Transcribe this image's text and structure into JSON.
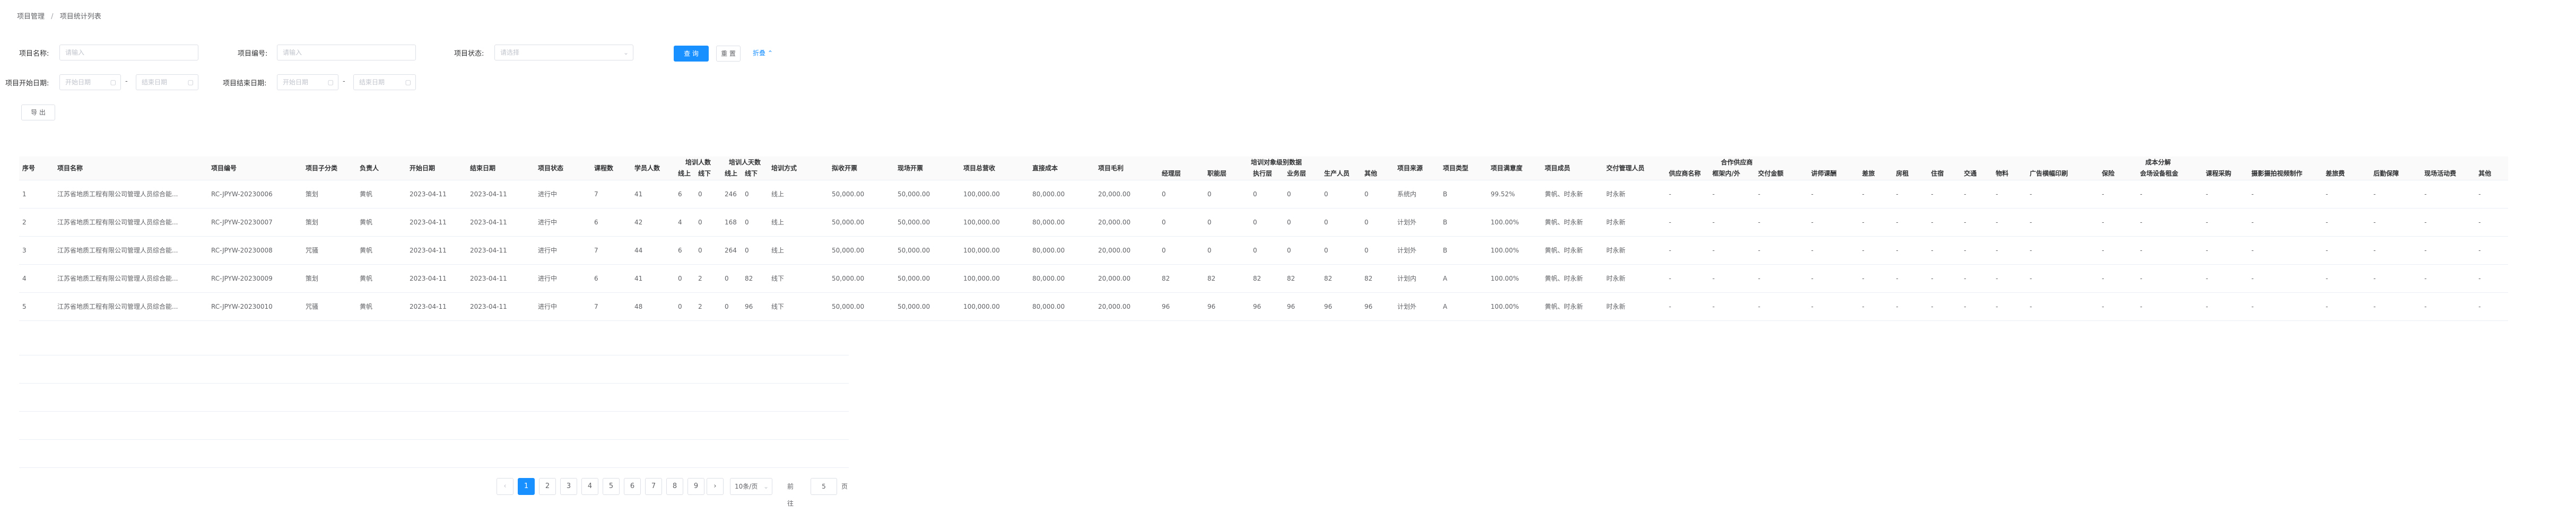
{
  "breadcrumb": {
    "parent": "项目管理",
    "separator": "/",
    "current": "项目统计列表"
  },
  "search": {
    "name_label": "项目名称:",
    "name_placeholder": "请输入",
    "code_label": "项目编号:",
    "code_placeholder": "请输入",
    "status_label": "项目状态:",
    "status_placeholder": "请选择",
    "start_label": "项目开始日期:",
    "start_from_placeholder": "开始日期",
    "start_to_placeholder": "结束日期",
    "end_label": "项目结束日期:",
    "end_from_placeholder": "开始日期",
    "end_to_placeholder": "结束日期",
    "range_sep": "-",
    "search_button": "查 询",
    "reset_button": "重 置",
    "collapse_button": "折叠"
  },
  "toolbar": {
    "export_button": "导 出"
  },
  "table": {
    "group_headers": {
      "trainee_count": "培训人数",
      "trainee_times": "培训人天数",
      "trainee_levels": "培训对象级别数据",
      "partner": "合作供应商",
      "cost_breakdown": "成本分解"
    },
    "headers": {
      "idx": "序号",
      "name": "项目名称",
      "code": "项目编号",
      "subtype": "项目子分类",
      "owner": "负责人",
      "start": "开始日期",
      "end": "结束日期",
      "status": "项目状态",
      "courses": "课程数",
      "students": "学员人数",
      "online": "线上",
      "offline": "线下",
      "online2": "线上",
      "offline2": "线下",
      "mode": "培训方式",
      "fee": "拟收开票",
      "invoiced": "现场开票",
      "total_rev": "项目总营收",
      "direct_cost": "直接成本",
      "gross": "项目毛利",
      "lvl_mgr": "经理层",
      "lvl_dept": "职能层",
      "lvl_exec": "执行层",
      "lvl_biz": "业务层",
      "lvl_prod": "生产人员",
      "lvl_other": "其他",
      "source": "项目来源",
      "category": "项目类型",
      "satisfaction": "项目满意度",
      "members": "项目成员",
      "delivery": "交付管理人员",
      "sup_name": "供应商名称",
      "sup_scope": "框架内/外",
      "sup_amount": "交付金额",
      "c_lecture": "讲师课酬",
      "c_travel": "差旅",
      "c_hotel": "房租",
      "c_stay": "住宿",
      "c_traffic": "交通",
      "c_material": "物料",
      "c_ad": "广告横幅印刷",
      "c_insurance": "保险",
      "c_venue": "会场设备租金",
      "c_course": "课程采购",
      "c_video": "摄影摄拍视频制作",
      "c_fee": "差旅费",
      "c_report": "后勤保障",
      "c_misc": "现场活动费",
      "c_other": "其他"
    },
    "rows": [
      {
        "idx": "1",
        "name": "江苏省地质工程有限公司管理人员综合能...",
        "code": "RC-JPYW-20230006",
        "subtype": "策划",
        "owner": "黄帆",
        "start": "2023-04-11",
        "end": "2023-04-11",
        "status": "进行中",
        "courses": "7",
        "students": "41",
        "online": "6",
        "offline": "0",
        "online2": "246",
        "offline2": "0",
        "mode": "线上",
        "fee": "50,000.00",
        "invoiced": "50,000.00",
        "total_rev": "100,000.00",
        "direct_cost": "80,000.00",
        "gross": "20,000.00",
        "lvl_mgr": "0",
        "lvl_dept": "0",
        "lvl_exec": "0",
        "lvl_biz": "0",
        "lvl_prod": "0",
        "lvl_other": "0",
        "source": "系统内",
        "category": "B",
        "satisfaction": "99.52%",
        "members": "黄帆、时永新",
        "delivery": "时永新"
      },
      {
        "idx": "2",
        "name": "江苏省地质工程有限公司管理人员综合能...",
        "code": "RC-JPYW-20230007",
        "subtype": "策划",
        "owner": "黄帆",
        "start": "2023-04-11",
        "end": "2023-04-11",
        "status": "进行中",
        "courses": "6",
        "students": "42",
        "online": "4",
        "offline": "0",
        "online2": "168",
        "offline2": "0",
        "mode": "线上",
        "fee": "50,000.00",
        "invoiced": "50,000.00",
        "total_rev": "100,000.00",
        "direct_cost": "80,000.00",
        "gross": "20,000.00",
        "lvl_mgr": "0",
        "lvl_dept": "0",
        "lvl_exec": "0",
        "lvl_biz": "0",
        "lvl_prod": "0",
        "lvl_other": "0",
        "source": "计划外",
        "category": "B",
        "satisfaction": "100.00%",
        "members": "黄帆、时永新",
        "delivery": "时永新"
      },
      {
        "idx": "3",
        "name": "江苏省地质工程有限公司管理人员综合能...",
        "code": "RC-JPYW-20230008",
        "subtype": "咒骚",
        "owner": "黄帆",
        "start": "2023-04-11",
        "end": "2023-04-11",
        "status": "进行中",
        "courses": "7",
        "students": "44",
        "online": "6",
        "offline": "0",
        "online2": "264",
        "offline2": "0",
        "mode": "线上",
        "fee": "50,000.00",
        "invoiced": "50,000.00",
        "total_rev": "100,000.00",
        "direct_cost": "80,000.00",
        "gross": "20,000.00",
        "lvl_mgr": "0",
        "lvl_dept": "0",
        "lvl_exec": "0",
        "lvl_biz": "0",
        "lvl_prod": "0",
        "lvl_other": "0",
        "source": "计划外",
        "category": "B",
        "satisfaction": "100.00%",
        "members": "黄帆、时永新",
        "delivery": "时永新"
      },
      {
        "idx": "4",
        "name": "江苏省地质工程有限公司管理人员综合能...",
        "code": "RC-JPYW-20230009",
        "subtype": "策划",
        "owner": "黄帆",
        "start": "2023-04-11",
        "end": "2023-04-11",
        "status": "进行中",
        "courses": "6",
        "students": "41",
        "online": "0",
        "offline": "2",
        "online2": "0",
        "offline2": "82",
        "mode": "线下",
        "fee": "50,000.00",
        "invoiced": "50,000.00",
        "total_rev": "100,000.00",
        "direct_cost": "80,000.00",
        "gross": "20,000.00",
        "lvl_mgr": "82",
        "lvl_dept": "82",
        "lvl_exec": "82",
        "lvl_biz": "82",
        "lvl_prod": "82",
        "lvl_other": "82",
        "source": "计划内",
        "category": "A",
        "satisfaction": "100.00%",
        "members": "黄帆、时永新",
        "delivery": "时永新"
      },
      {
        "idx": "5",
        "name": "江苏省地质工程有限公司管理人员综合能...",
        "code": "RC-JPYW-20230010",
        "subtype": "咒骚",
        "owner": "黄帆",
        "start": "2023-04-11",
        "end": "2023-04-11",
        "status": "进行中",
        "courses": "7",
        "students": "48",
        "online": "0",
        "offline": "2",
        "online2": "0",
        "offline2": "96",
        "mode": "线下",
        "fee": "50,000.00",
        "invoiced": "50,000.00",
        "total_rev": "100,000.00",
        "direct_cost": "80,000.00",
        "gross": "20,000.00",
        "lvl_mgr": "96",
        "lvl_dept": "96",
        "lvl_exec": "96",
        "lvl_biz": "96",
        "lvl_prod": "96",
        "lvl_other": "96",
        "source": "计划外",
        "category": "A",
        "satisfaction": "100.00%",
        "members": "黄帆、时永新",
        "delivery": "时永新"
      }
    ],
    "dash": "-"
  },
  "pagination": {
    "prev": "‹",
    "next": "›",
    "pages": [
      "1",
      "2",
      "3",
      "4",
      "5",
      "6",
      "7",
      "8",
      "9"
    ],
    "active_page": "1",
    "page_size": "10条/页",
    "jump_label": "前往",
    "jump_value": "5",
    "jump_suffix": "页"
  },
  "colors": {
    "primary": "#1890ff",
    "border": "#dcdfe6",
    "row_line": "#ebeef5"
  }
}
